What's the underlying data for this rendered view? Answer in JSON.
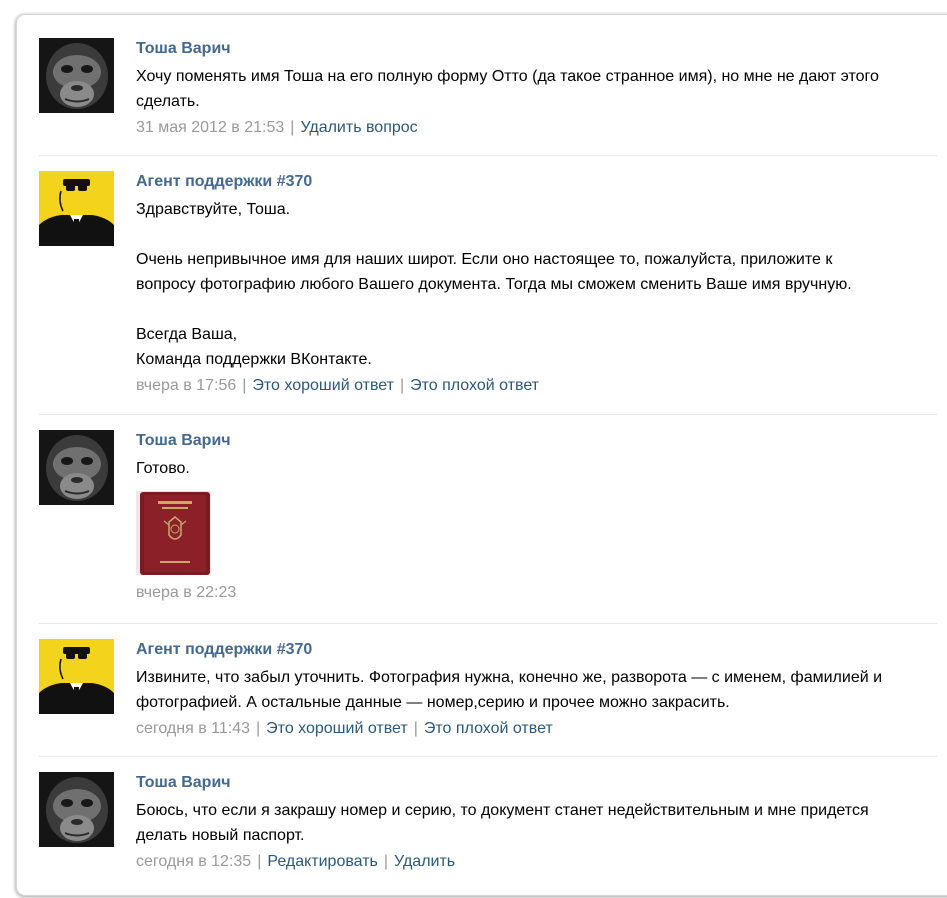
{
  "messages": [
    {
      "author": "Тоша Варич",
      "lines": [
        "Хочу поменять имя Тоша на его полную форму Отто (да такое странное имя), но мне не дают этого",
        "сделать."
      ],
      "time": "31 мая 2012 в 21:53",
      "actions": [
        "Удалить вопрос"
      ]
    },
    {
      "author": "Агент поддержки #370",
      "lines": [
        "Здравствуйте, Тоша.",
        "",
        "Очень непривычное имя для наших широт. Если оно настоящее то, пожалуйста, приложите к",
        "вопросу фотографию любого Вашего документа. Тогда мы сможем сменить Ваше имя вручную.",
        "",
        "Всегда Ваша,",
        "Команда поддержки ВКонтакте."
      ],
      "time": "вчера в 17:56",
      "actions": [
        "Это хороший ответ",
        "Это плохой ответ"
      ]
    },
    {
      "author": "Тоша Варич",
      "lines": [
        "Готово."
      ],
      "attachment": "passport-photo",
      "time": "вчера в 22:23",
      "actions": []
    },
    {
      "author": "Агент поддержки #370",
      "lines": [
        "Извините, что забыл уточнить. Фотография нужна, конечно же, разворота — с именем, фамилией и",
        "фотографией. А остальные данные — номер,серию и прочее можно закрасить."
      ],
      "time": "сегодня в 11:43",
      "actions": [
        "Это хороший ответ",
        "Это плохой ответ"
      ]
    },
    {
      "author": "Тоша Варич",
      "lines": [
        "Боюсь, что если я закрашу номер и серию, то документ станет недействительным и мне придется",
        "делать новый паспорт."
      ],
      "time": "сегодня в 12:35",
      "actions": [
        "Редактировать",
        "Удалить"
      ]
    }
  ],
  "colors": {
    "author": "#45688e",
    "link": "#2b587a",
    "meta": "#999999",
    "agent_bg": "#f4d31c",
    "passport": "#7a1a22"
  }
}
